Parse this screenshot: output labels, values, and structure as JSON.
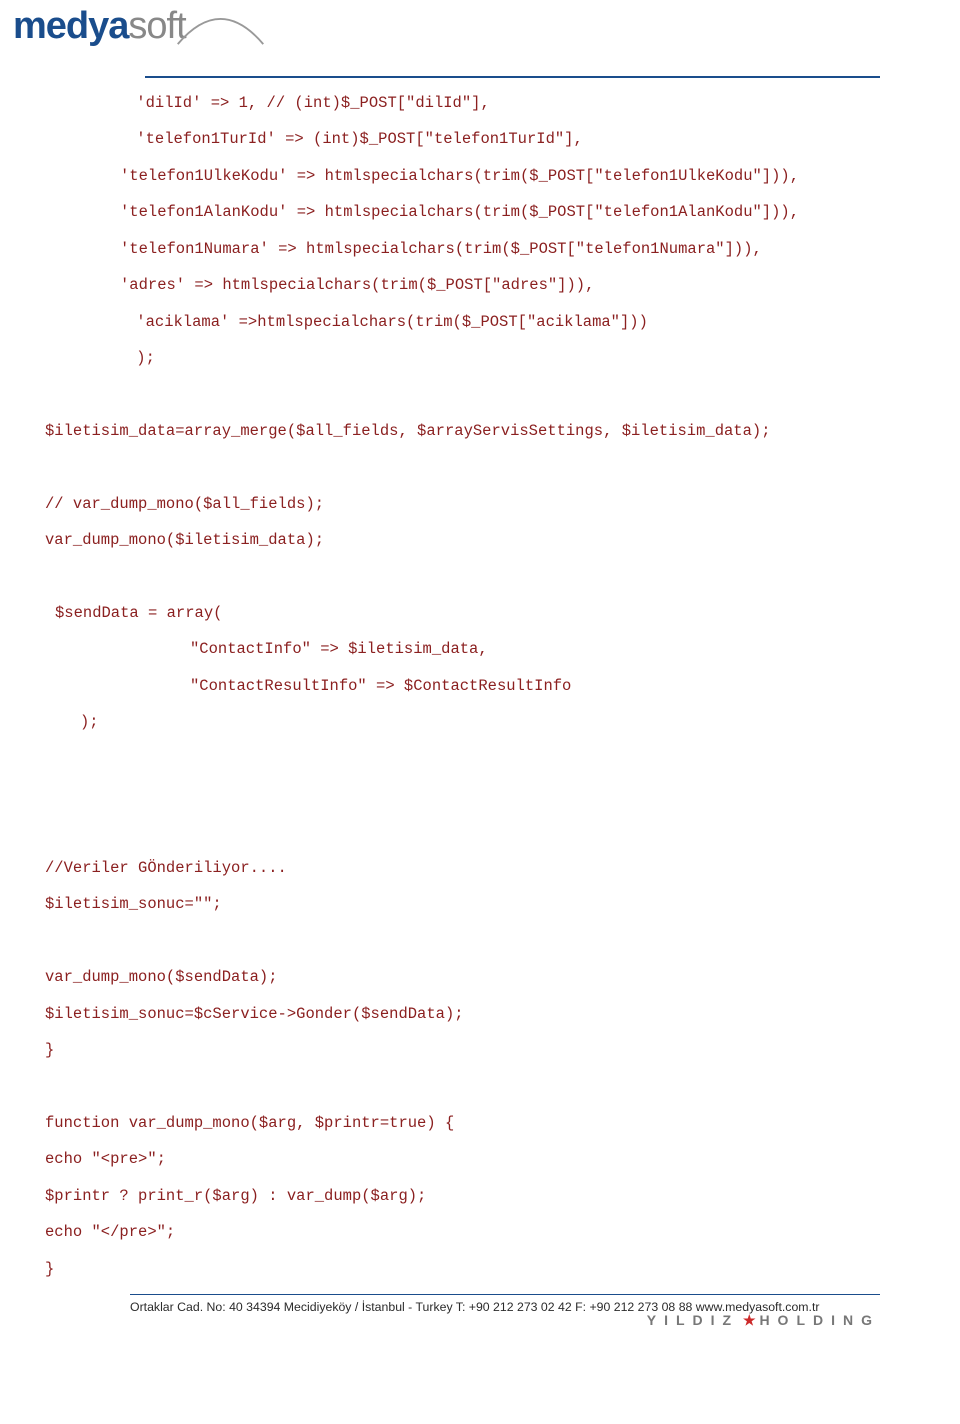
{
  "logo": {
    "prefix": "medya",
    "suffix": "soft"
  },
  "code": {
    "lines": [
      {
        "class": "indent-1",
        "text": " 'dilId' => 1, // (int)$_POST[\"dilId\"],"
      },
      {
        "class": "indent-1",
        "text": " 'telefon1TurId' => (int)$_POST[\"telefon1TurId\"],"
      },
      {
        "class": "indent-2",
        "text": "'telefon1UlkeKodu' => htmlspecialchars(trim($_POST[\"telefon1UlkeKodu\"])),"
      },
      {
        "class": "indent-2",
        "text": "'telefon1AlanKodu' => htmlspecialchars(trim($_POST[\"telefon1AlanKodu\"])),"
      },
      {
        "class": "indent-2",
        "text": "'telefon1Numara' => htmlspecialchars(trim($_POST[\"telefon1Numara\"])),"
      },
      {
        "class": "indent-2",
        "text": "'adres' => htmlspecialchars(trim($_POST[\"adres\"])),"
      },
      {
        "class": "indent-1",
        "text": " 'aciklama' =>htmlspecialchars(trim($_POST[\"aciklama\"]))"
      },
      {
        "class": "indent-1",
        "text": " );"
      },
      {
        "class": "",
        "text": ""
      },
      {
        "class": "",
        "text": "$iletisim_data=array_merge($all_fields, $arrayServisSettings, $iletisim_data);"
      },
      {
        "class": "",
        "text": ""
      },
      {
        "class": "",
        "text": "// var_dump_mono($all_fields);"
      },
      {
        "class": "",
        "text": "var_dump_mono($iletisim_data);"
      },
      {
        "class": "",
        "text": ""
      },
      {
        "class": "indent-3",
        "text": "$sendData = array("
      },
      {
        "class": "indent-4",
        "text": "\"ContactInfo\" => $iletisim_data,"
      },
      {
        "class": "indent-4",
        "text": "\"ContactResultInfo\" => $ContactResultInfo"
      },
      {
        "class": "indent-5",
        "text": ");"
      },
      {
        "class": "",
        "text": ""
      },
      {
        "class": "",
        "text": ""
      },
      {
        "class": "",
        "text": ""
      },
      {
        "class": "",
        "text": "//Veriler GÖnderiliyor...."
      },
      {
        "class": "",
        "text": "$iletisim_sonuc=\"\";"
      },
      {
        "class": "",
        "text": ""
      },
      {
        "class": "",
        "text": "var_dump_mono($sendData);"
      },
      {
        "class": "",
        "text": "$iletisim_sonuc=$cService->Gonder($sendData);"
      },
      {
        "class": "",
        "text": "}"
      },
      {
        "class": "",
        "text": ""
      },
      {
        "class": "",
        "text": "function var_dump_mono($arg, $printr=true) {"
      },
      {
        "class": "",
        "text": "echo \"<pre>\";"
      },
      {
        "class": "",
        "text": "$printr ? print_r($arg) : var_dump($arg);"
      },
      {
        "class": "",
        "text": "echo \"</pre>\";"
      },
      {
        "class": "",
        "text": "}"
      }
    ]
  },
  "footer": {
    "address": "Ortaklar Cad. No: 40 34394 Mecidiyeköy / İstanbul - Turkey   T: +90 212 273 02 42  F: +90 212 273 08 88  www.medyasoft.com.tr",
    "holding_prefix": "YILDIZ",
    "holding_suffix": "HOLDING"
  }
}
